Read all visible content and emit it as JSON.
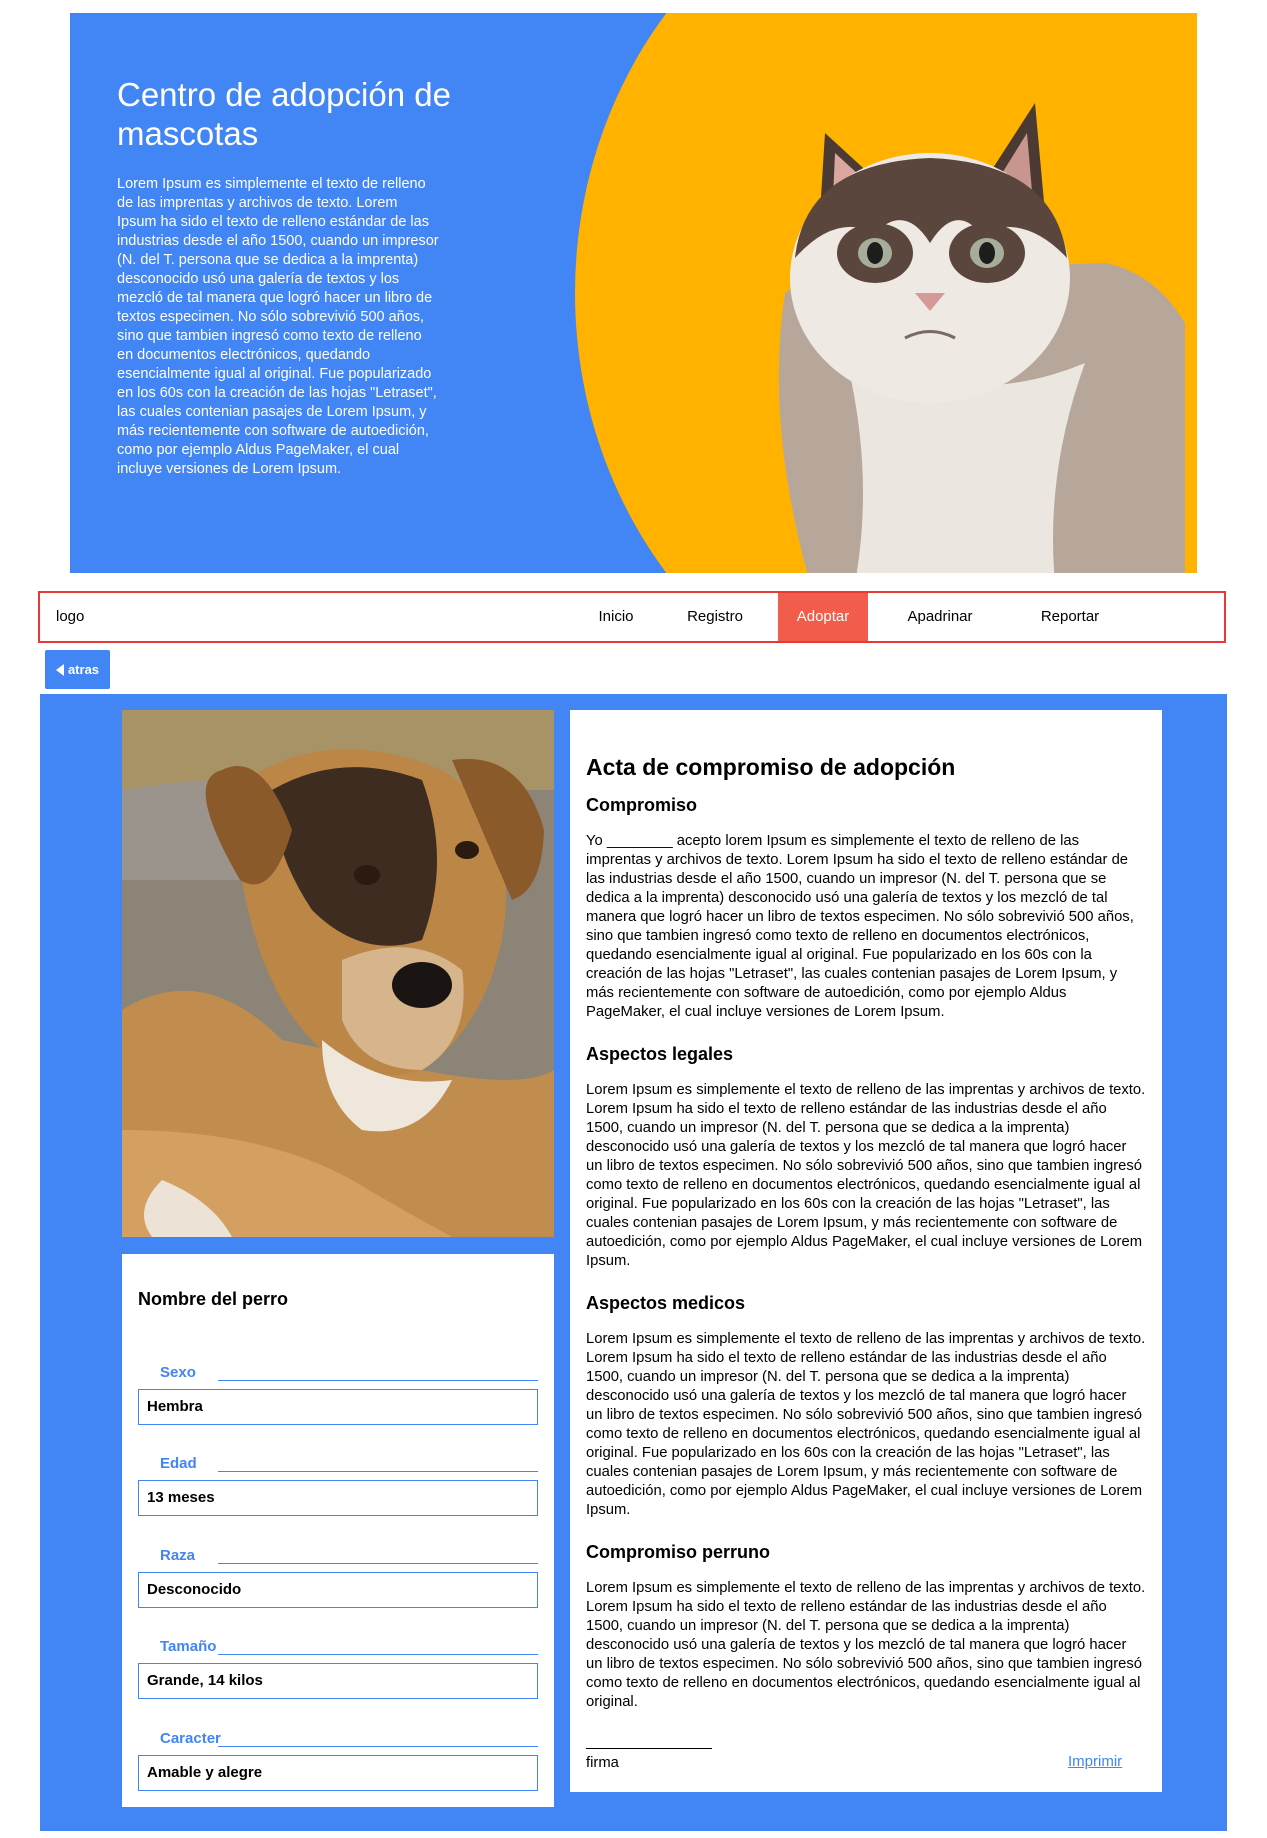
{
  "hero": {
    "title": "Centro de adopción de mascotas",
    "text": "Lorem Ipsum es simplemente el texto de relleno de las imprentas y archivos de texto. Lorem Ipsum ha sido el texto de relleno estándar de las industrias desde el año 1500, cuando un impresor (N. del T. persona que se dedica a la imprenta) desconocido usó una galería de textos y los mezcló de tal manera que logró hacer un libro de textos especimen. No sólo sobrevivió 500 años, sino que tambien ingresó como texto de relleno en documentos electrónicos, quedando esencialmente igual al original. Fue popularizado en los 60s con la creación de las hojas \"Letraset\", las cuales contenian pasajes de Lorem Ipsum, y más recientemente con software de autoedición, como por ejemplo Aldus PageMaker, el cual incluye versiones de Lorem Ipsum.",
    "bg_color": "#4285f4",
    "accent_color": "#ffb300"
  },
  "nav": {
    "logo": "logo",
    "items": [
      "Inicio",
      "Registro",
      "Adoptar",
      "Apadrinar",
      "Reportar"
    ],
    "active": "Adoptar",
    "border_color": "#e53935",
    "active_color": "#f25c4a"
  },
  "back_button": {
    "label": "atras",
    "icon": "caret-left-icon"
  },
  "dog": {
    "name_heading": "Nombre del perro",
    "fields": [
      {
        "label": "Sexo",
        "value": "Hembra"
      },
      {
        "label": "Edad",
        "value": "13 meses"
      },
      {
        "label": "Raza",
        "value": "Desconocido"
      },
      {
        "label": "Tamaño",
        "value": "Grande, 14 kilos"
      },
      {
        "label": "Caracter",
        "value": "Amable y alegre"
      }
    ]
  },
  "document": {
    "title": "Acta de compromiso de adopción",
    "sections": [
      {
        "heading": "Compromiso",
        "text": "Yo ________ acepto lorem Ipsum es simplemente el texto de relleno de las imprentas y archivos de texto. Lorem Ipsum ha sido el texto de relleno estándar de las industrias desde el año 1500, cuando un impresor (N. del T. persona que se dedica a la imprenta) desconocido usó una galería de textos y los mezcló de tal manera que logró hacer un libro de textos especimen. No sólo sobrevivió 500 años, sino que tambien ingresó como texto de relleno en documentos electrónicos, quedando esencialmente igual al original. Fue popularizado en los 60s con la creación de las hojas \"Letraset\", las cuales contenian pasajes de Lorem Ipsum, y más recientemente con software de autoedición, como por ejemplo Aldus PageMaker, el cual incluye versiones de Lorem Ipsum."
      },
      {
        "heading": "Aspectos legales",
        "text": "Lorem Ipsum es simplemente el texto de relleno de las imprentas y archivos de texto. Lorem Ipsum ha sido el texto de relleno estándar de las industrias desde el año 1500, cuando un impresor (N. del T. persona que se dedica a la imprenta) desconocido usó una galería de textos y los mezcló de tal manera que logró hacer un libro de textos especimen. No sólo sobrevivió 500 años, sino que tambien ingresó como texto de relleno en documentos electrónicos, quedando esencialmente igual al original. Fue popularizado en los 60s con la creación de las hojas \"Letraset\", las cuales contenian pasajes de Lorem Ipsum, y más recientemente con software de autoedición, como por ejemplo Aldus PageMaker, el cual incluye versiones de Lorem Ipsum."
      },
      {
        "heading": "Aspectos medicos",
        "text": "Lorem Ipsum es simplemente el texto de relleno de las imprentas y archivos de texto. Lorem Ipsum ha sido el texto de relleno estándar de las industrias desde el año 1500, cuando un impresor (N. del T. persona que se dedica a la imprenta) desconocido usó una galería de textos y los mezcló de tal manera que logró hacer un libro de textos especimen. No sólo sobrevivió 500 años, sino que tambien ingresó como texto de relleno en documentos electrónicos, quedando esencialmente igual al original. Fue popularizado en los 60s con la creación de las hojas \"Letraset\", las cuales contenian pasajes de Lorem Ipsum, y más recientemente con software de autoedición, como por ejemplo Aldus PageMaker, el cual incluye versiones de Lorem Ipsum."
      },
      {
        "heading": "Compromiso perruno",
        "text": "Lorem Ipsum es simplemente el texto de relleno de las imprentas y archivos de texto. Lorem Ipsum ha sido el texto de relleno estándar de las industrias desde el año 1500, cuando un impresor (N. del T. persona que se dedica a la imprenta) desconocido usó una galería de textos y los mezcló de tal manera que logró hacer un libro de textos especimen. No sólo sobrevivió 500 años, sino que tambien ingresó como texto de relleno en documentos electrónicos, quedando esencialmente igual al original."
      }
    ],
    "signature_label": "firma",
    "print_link": "Imprimir"
  }
}
